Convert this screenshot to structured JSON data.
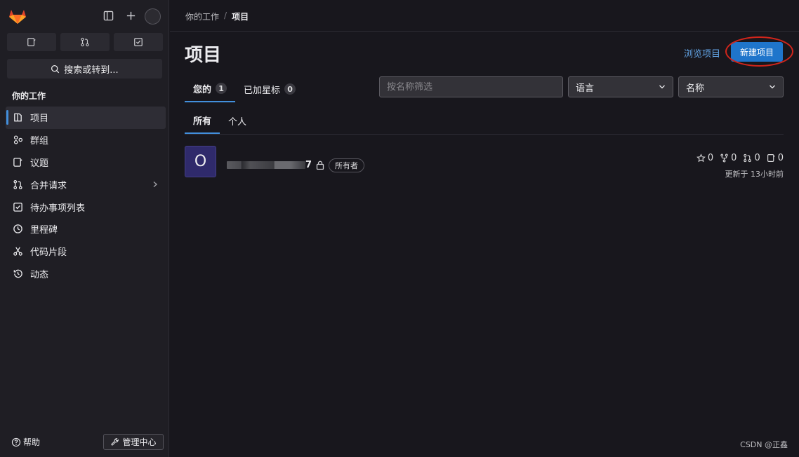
{
  "sidebar": {
    "search_label": "搜索或转到...",
    "section_title": "你的工作",
    "items": [
      {
        "label": "项目",
        "icon": "project-icon",
        "active": true
      },
      {
        "label": "群组",
        "icon": "group-icon"
      },
      {
        "label": "议题",
        "icon": "issues-icon"
      },
      {
        "label": "合并请求",
        "icon": "merge-request-icon"
      },
      {
        "label": "待办事项列表",
        "icon": "todo-icon"
      },
      {
        "label": "里程碑",
        "icon": "milestone-icon"
      },
      {
        "label": "代码片段",
        "icon": "snippet-icon"
      },
      {
        "label": "动态",
        "icon": "activity-icon"
      }
    ],
    "help_label": "帮助",
    "admin_label": "管理中心"
  },
  "breadcrumb": {
    "parent": "你的工作",
    "separator": "/",
    "current": "项目"
  },
  "page": {
    "title": "项目",
    "browse_link": "浏览项目",
    "new_button": "新建项目"
  },
  "tabs": [
    {
      "label": "您的",
      "count": "1",
      "active": true
    },
    {
      "label": "已加星标",
      "count": "0"
    }
  ],
  "filter": {
    "placeholder": "按名称筛选",
    "language": "语言",
    "sort": "名称"
  },
  "subtabs": [
    {
      "label": "所有",
      "active": true
    },
    {
      "label": "个人"
    }
  ],
  "project": {
    "avatar_letter": "O",
    "name_suffix": "7",
    "role": "所有者",
    "stars": "0",
    "forks": "0",
    "merge_requests": "0",
    "issues": "0",
    "updated": "更新于 13小时前"
  },
  "watermark": "CSDN @正鑫",
  "colors": {
    "accent": "#1f75cb",
    "link": "#63a6e9",
    "active_bar": "#428fdc",
    "highlight_circle": "#d1251b"
  }
}
